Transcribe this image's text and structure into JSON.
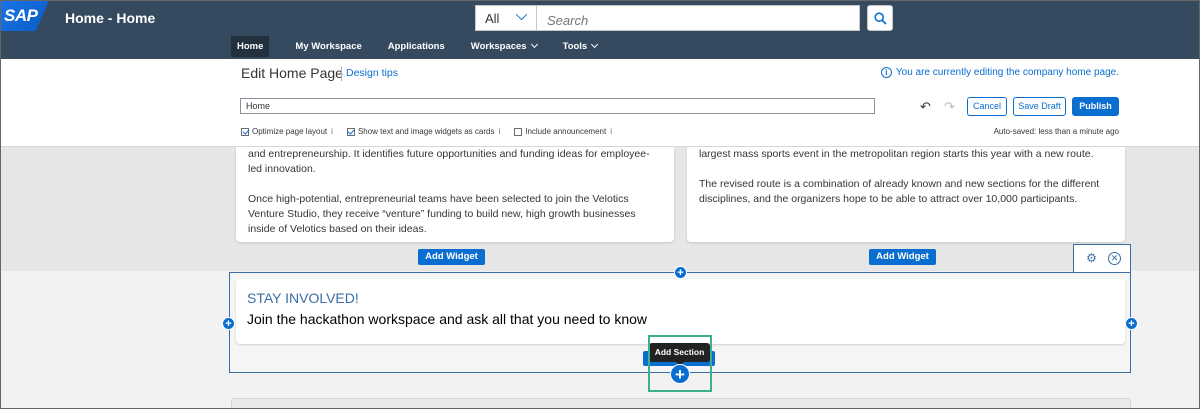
{
  "shell": {
    "logo": "SAP",
    "title": "Home - Home",
    "search_scope": "All",
    "search_placeholder": "Search",
    "nav": [
      {
        "label": "Home"
      },
      {
        "label": "My Workspace"
      },
      {
        "label": "Applications"
      },
      {
        "label": "Workspaces"
      },
      {
        "label": "Tools"
      }
    ]
  },
  "edit": {
    "title": "Edit Home Page",
    "design_tips": "Design tips",
    "editing_note": "You are currently editing the company home page.",
    "page_name_value": "Home",
    "cancel": "Cancel",
    "save_draft": "Save Draft",
    "publish": "Publish",
    "options": [
      {
        "label": "Optimize page layout",
        "checked": true
      },
      {
        "label": "Show text and image widgets as cards",
        "checked": true
      },
      {
        "label": "Include announcement",
        "checked": false
      }
    ],
    "autosaved": "Auto-saved: less than a minute ago"
  },
  "content": {
    "left_card": {
      "p1": "and entrepreneurship. It identifies future opportunities and funding ideas for employee-led innovation.",
      "p2": "Once high-potential, entrepreneurial teams have been selected to join the Velotics Venture Studio, they receive “venture” funding to build new, high growth businesses inside of Velotics based on their ideas."
    },
    "right_card": {
      "p1": "largest mass sports event in the metropolitan region starts this year with a new route.",
      "p2": "The revised route is a combination of already known and new sections for the different disciplines, and the organizers hope to be able to attract over 10,000 participants."
    },
    "add_widget": "Add Widget",
    "stay": {
      "title": "STAY INVOLVED!",
      "subtitle": "Join the hackathon workspace and ask all that you need to know"
    },
    "add_section_tooltip": "Add Section"
  },
  "colors": {
    "shell_bg": "#354a5f",
    "accent": "#0a6ed1",
    "highlight": "#3cb08a"
  }
}
